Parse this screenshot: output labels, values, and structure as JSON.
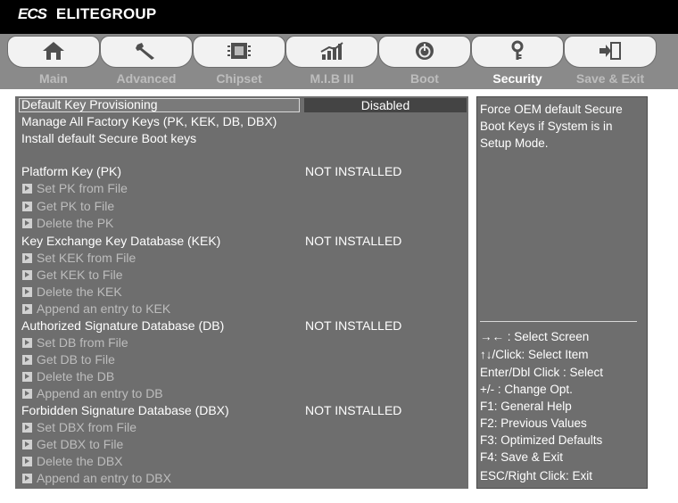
{
  "brand": {
    "logo_mark": "ECS",
    "name": "ELITEGROUP"
  },
  "tabs": [
    {
      "label": "Main",
      "icon": "home-icon"
    },
    {
      "label": "Advanced",
      "icon": "wrench-icon"
    },
    {
      "label": "Chipset",
      "icon": "chip-icon"
    },
    {
      "label": "M.I.B III",
      "icon": "chart-icon"
    },
    {
      "label": "Boot",
      "icon": "power-icon"
    },
    {
      "label": "Security",
      "icon": "key-icon",
      "active": true
    },
    {
      "label": "Save & Exit",
      "icon": "exit-icon"
    }
  ],
  "main": {
    "default_key_provisioning": {
      "label": "Default Key Provisioning",
      "value": "Disabled"
    },
    "manage_all_keys": "Manage All Factory Keys (PK, KEK, DB, DBX)",
    "install_default": "Install default Secure Boot keys",
    "pk": {
      "label": "Platform Key (PK)",
      "status": "NOT INSTALLED",
      "items": [
        "Set PK from File",
        "Get PK to File",
        "Delete the PK"
      ]
    },
    "kek": {
      "label": "Key Exchange Key Database (KEK)",
      "status": "NOT INSTALLED",
      "items": [
        "Set KEK from File",
        "Get KEK to File",
        "Delete the KEK",
        "Append an entry to KEK"
      ]
    },
    "db": {
      "label": "Authorized Signature Database (DB)",
      "status": "NOT INSTALLED",
      "items": [
        "Set DB from File",
        "Get DB to File",
        "Delete the DB",
        "Append an entry to DB"
      ]
    },
    "dbx": {
      "label": "Forbidden Signature Database (DBX)",
      "status": "NOT INSTALLED",
      "items": [
        "Set DBX from File",
        "Get DBX to File",
        "Delete the DBX",
        "Append an entry to DBX"
      ]
    }
  },
  "help": {
    "text": "Force OEM default Secure Boot Keys if System is in Setup Mode.",
    "keys": [
      "→← : Select Screen",
      "↑↓/Click: Select Item",
      "Enter/Dbl Click : Select",
      "+/- : Change Opt.",
      "F1: General Help",
      "F2: Previous Values",
      "F3: Optimized Defaults",
      "F4: Save & Exit",
      "ESC/Right Click: Exit"
    ]
  }
}
